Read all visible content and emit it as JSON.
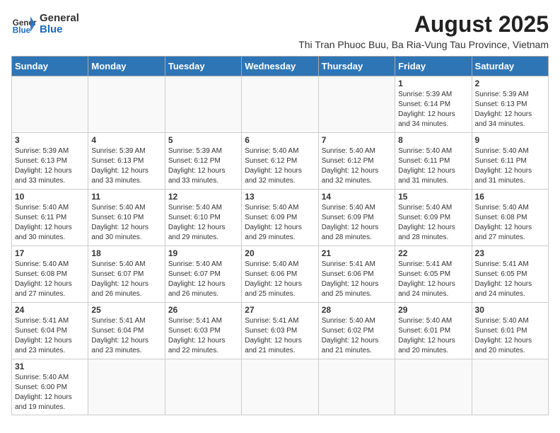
{
  "header": {
    "logo_general": "General",
    "logo_blue": "Blue",
    "main_title": "August 2025",
    "subtitle": "Thi Tran Phuoc Buu, Ba Ria-Vung Tau Province, Vietnam"
  },
  "weekdays": [
    "Sunday",
    "Monday",
    "Tuesday",
    "Wednesday",
    "Thursday",
    "Friday",
    "Saturday"
  ],
  "weeks": [
    [
      {
        "day": "",
        "info": ""
      },
      {
        "day": "",
        "info": ""
      },
      {
        "day": "",
        "info": ""
      },
      {
        "day": "",
        "info": ""
      },
      {
        "day": "",
        "info": ""
      },
      {
        "day": "1",
        "info": "Sunrise: 5:39 AM\nSunset: 6:14 PM\nDaylight: 12 hours and 34 minutes."
      },
      {
        "day": "2",
        "info": "Sunrise: 5:39 AM\nSunset: 6:13 PM\nDaylight: 12 hours and 34 minutes."
      }
    ],
    [
      {
        "day": "3",
        "info": "Sunrise: 5:39 AM\nSunset: 6:13 PM\nDaylight: 12 hours and 33 minutes."
      },
      {
        "day": "4",
        "info": "Sunrise: 5:39 AM\nSunset: 6:13 PM\nDaylight: 12 hours and 33 minutes."
      },
      {
        "day": "5",
        "info": "Sunrise: 5:39 AM\nSunset: 6:12 PM\nDaylight: 12 hours and 33 minutes."
      },
      {
        "day": "6",
        "info": "Sunrise: 5:40 AM\nSunset: 6:12 PM\nDaylight: 12 hours and 32 minutes."
      },
      {
        "day": "7",
        "info": "Sunrise: 5:40 AM\nSunset: 6:12 PM\nDaylight: 12 hours and 32 minutes."
      },
      {
        "day": "8",
        "info": "Sunrise: 5:40 AM\nSunset: 6:11 PM\nDaylight: 12 hours and 31 minutes."
      },
      {
        "day": "9",
        "info": "Sunrise: 5:40 AM\nSunset: 6:11 PM\nDaylight: 12 hours and 31 minutes."
      }
    ],
    [
      {
        "day": "10",
        "info": "Sunrise: 5:40 AM\nSunset: 6:11 PM\nDaylight: 12 hours and 30 minutes."
      },
      {
        "day": "11",
        "info": "Sunrise: 5:40 AM\nSunset: 6:10 PM\nDaylight: 12 hours and 30 minutes."
      },
      {
        "day": "12",
        "info": "Sunrise: 5:40 AM\nSunset: 6:10 PM\nDaylight: 12 hours and 29 minutes."
      },
      {
        "day": "13",
        "info": "Sunrise: 5:40 AM\nSunset: 6:09 PM\nDaylight: 12 hours and 29 minutes."
      },
      {
        "day": "14",
        "info": "Sunrise: 5:40 AM\nSunset: 6:09 PM\nDaylight: 12 hours and 28 minutes."
      },
      {
        "day": "15",
        "info": "Sunrise: 5:40 AM\nSunset: 6:09 PM\nDaylight: 12 hours and 28 minutes."
      },
      {
        "day": "16",
        "info": "Sunrise: 5:40 AM\nSunset: 6:08 PM\nDaylight: 12 hours and 27 minutes."
      }
    ],
    [
      {
        "day": "17",
        "info": "Sunrise: 5:40 AM\nSunset: 6:08 PM\nDaylight: 12 hours and 27 minutes."
      },
      {
        "day": "18",
        "info": "Sunrise: 5:40 AM\nSunset: 6:07 PM\nDaylight: 12 hours and 26 minutes."
      },
      {
        "day": "19",
        "info": "Sunrise: 5:40 AM\nSunset: 6:07 PM\nDaylight: 12 hours and 26 minutes."
      },
      {
        "day": "20",
        "info": "Sunrise: 5:40 AM\nSunset: 6:06 PM\nDaylight: 12 hours and 25 minutes."
      },
      {
        "day": "21",
        "info": "Sunrise: 5:41 AM\nSunset: 6:06 PM\nDaylight: 12 hours and 25 minutes."
      },
      {
        "day": "22",
        "info": "Sunrise: 5:41 AM\nSunset: 6:05 PM\nDaylight: 12 hours and 24 minutes."
      },
      {
        "day": "23",
        "info": "Sunrise: 5:41 AM\nSunset: 6:05 PM\nDaylight: 12 hours and 24 minutes."
      }
    ],
    [
      {
        "day": "24",
        "info": "Sunrise: 5:41 AM\nSunset: 6:04 PM\nDaylight: 12 hours and 23 minutes."
      },
      {
        "day": "25",
        "info": "Sunrise: 5:41 AM\nSunset: 6:04 PM\nDaylight: 12 hours and 23 minutes."
      },
      {
        "day": "26",
        "info": "Sunrise: 5:41 AM\nSunset: 6:03 PM\nDaylight: 12 hours and 22 minutes."
      },
      {
        "day": "27",
        "info": "Sunrise: 5:41 AM\nSunset: 6:03 PM\nDaylight: 12 hours and 21 minutes."
      },
      {
        "day": "28",
        "info": "Sunrise: 5:40 AM\nSunset: 6:02 PM\nDaylight: 12 hours and 21 minutes."
      },
      {
        "day": "29",
        "info": "Sunrise: 5:40 AM\nSunset: 6:01 PM\nDaylight: 12 hours and 20 minutes."
      },
      {
        "day": "30",
        "info": "Sunrise: 5:40 AM\nSunset: 6:01 PM\nDaylight: 12 hours and 20 minutes."
      }
    ],
    [
      {
        "day": "31",
        "info": "Sunrise: 5:40 AM\nSunset: 6:00 PM\nDaylight: 12 hours and 19 minutes."
      },
      {
        "day": "",
        "info": ""
      },
      {
        "day": "",
        "info": ""
      },
      {
        "day": "",
        "info": ""
      },
      {
        "day": "",
        "info": ""
      },
      {
        "day": "",
        "info": ""
      },
      {
        "day": "",
        "info": ""
      }
    ]
  ]
}
